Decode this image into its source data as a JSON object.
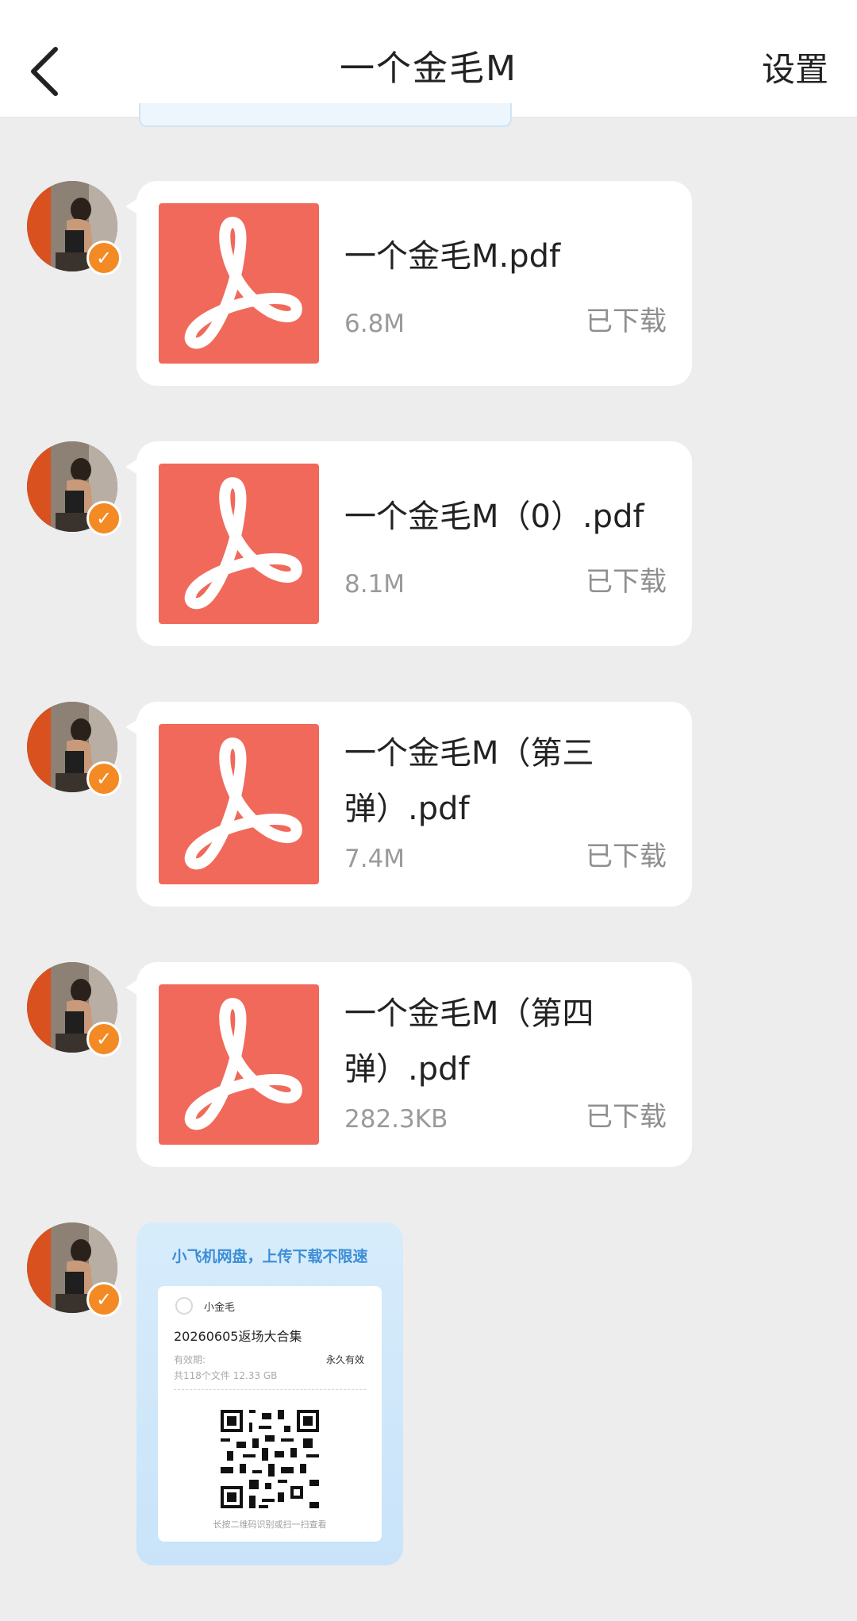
{
  "header": {
    "title": "一个金毛M",
    "settings_label": "设置"
  },
  "messages": [
    {
      "name": "一个金毛M.pdf",
      "size": "6.8M",
      "status": "已下载"
    },
    {
      "name": "一个金毛M（0）.pdf",
      "size": "8.1M",
      "status": "已下载"
    },
    {
      "name": "一个金毛M（第三弹）.pdf",
      "size": "7.4M",
      "status": "已下载"
    },
    {
      "name": "一个金毛M（第四弹）.pdf",
      "size": "282.3KB",
      "status": "已下载"
    }
  ],
  "share_card": {
    "header": "小飞机网盘，上传下载不限速",
    "user": "小金毛",
    "folder": "20260605返场大合集",
    "validity_label": "有效期:",
    "validity": "永久有效",
    "count": "共118个文件  12.33 GB",
    "hint": "长按二维码识别或扫一扫查看"
  },
  "colors": {
    "pdf_icon": "#f0695a",
    "verified_badge": "#f48a24",
    "share_accent": "#3c8ed6"
  }
}
